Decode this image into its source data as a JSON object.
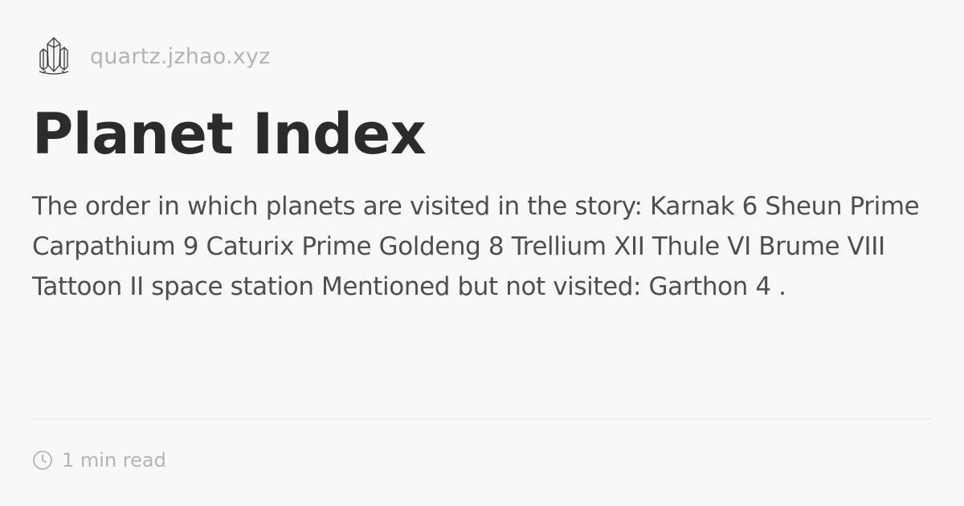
{
  "header": {
    "site_name": "quartz.jzhao.xyz",
    "logo_icon": "crystal-icon"
  },
  "page": {
    "title": "Planet Index",
    "description": "The order in which planets are visited in the story: Karnak 6 Sheun Prime Carpathium 9 Caturix Prime Goldeng 8 Trellium XII Thule VI Brume VIII Tattoon II space station Mentioned but not visited: Garthon 4 ."
  },
  "meta": {
    "reading_time": "1 min read",
    "icon": "clock-icon"
  },
  "colors": {
    "background": "#f9f8f8",
    "title": "#2b2b2b",
    "body_text": "#4e4e4e",
    "muted": "#b4b4b4",
    "divider": "#e5e5e5"
  }
}
